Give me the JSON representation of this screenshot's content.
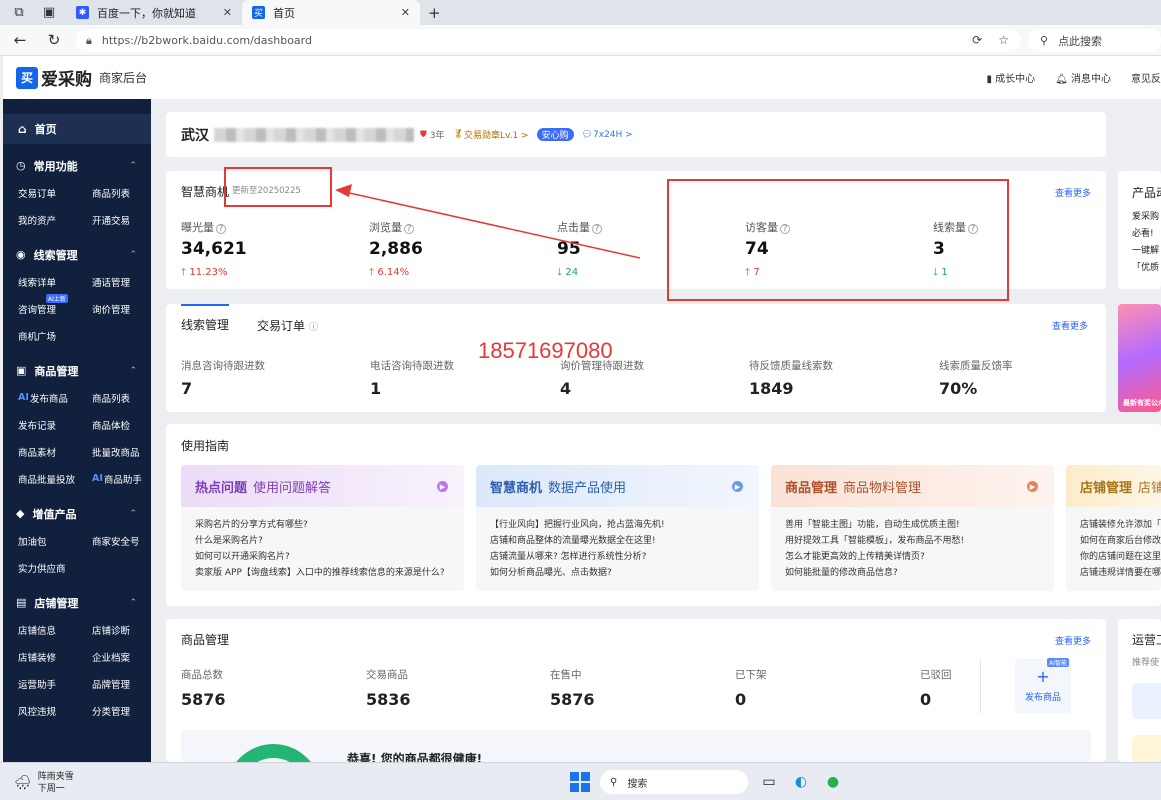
{
  "browser": {
    "tabs": [
      {
        "label": "百度一下，你就知道",
        "icon": "baidu-paw-icon"
      },
      {
        "label": "首页",
        "icon": "b2b-icon"
      }
    ],
    "url": "https://b2bwork.baidu.com/dashboard",
    "search_placeholder": "点此搜索"
  },
  "header": {
    "logo_mark": "买",
    "logo_text": "爱采购",
    "subtitle": "商家后台",
    "links": [
      "成长中心",
      "消息中心",
      "意见反"
    ]
  },
  "sidebar": {
    "home": "首页",
    "groups": [
      {
        "title": "常用功能",
        "items": [
          "交易订单",
          "商品列表",
          "我的资产",
          "开通交易"
        ]
      },
      {
        "title": "线索管理",
        "items": [
          "线索详单",
          "通话管理",
          "咨询管理",
          "询价管理",
          "商机广场"
        ],
        "badge": "AI上新"
      },
      {
        "title": "商品管理",
        "items": [
          "发布商品",
          "商品列表",
          "发布记录",
          "商品体检",
          "商品素材",
          "批量改商品",
          "商品批量投放",
          "商品助手"
        ]
      },
      {
        "title": "增值产品",
        "items": [
          "加油包",
          "商家安全号",
          "实力供应商"
        ]
      },
      {
        "title": "店铺管理",
        "items": [
          "店铺信息",
          "店铺诊断",
          "店铺装修",
          "企业档案",
          "运营助手",
          "品牌管理",
          "风控违规",
          "分类管理"
        ]
      }
    ]
  },
  "shop": {
    "name_prefix": "武汉",
    "years": "3年",
    "level": "交易勋章Lv.1 >",
    "assurance": "安心购",
    "service": "7x24H >"
  },
  "smart": {
    "title": "智慧商机",
    "updated": "更新至20250225",
    "more": "查看更多",
    "metrics": [
      {
        "label": "曝光量",
        "value": "34,621",
        "change": "11.23%",
        "dir": "up"
      },
      {
        "label": "浏览量",
        "value": "2,886",
        "change": "6.14%",
        "dir": "up"
      },
      {
        "label": "点击量",
        "value": "95",
        "change": "24",
        "dir": "down"
      },
      {
        "label": "访客量",
        "value": "74",
        "change": "7",
        "dir": "up"
      },
      {
        "label": "线索量",
        "value": "3",
        "change": "1",
        "dir": "down"
      }
    ]
  },
  "leads": {
    "tabs": [
      "线索管理",
      "交易订单"
    ],
    "more": "查看更多",
    "metrics": [
      {
        "label": "消息咨询待跟进数",
        "value": "7"
      },
      {
        "label": "电话咨询待跟进数",
        "value": "1"
      },
      {
        "label": "询价管理待跟进数",
        "value": "4"
      },
      {
        "label": "待反馈质量线索数",
        "value": "1849"
      },
      {
        "label": "线索质量反馈率",
        "value": "70%"
      }
    ]
  },
  "overlay_phone": "18571697080",
  "guide": {
    "title": "使用指南",
    "cards": [
      {
        "bold": "热点问题",
        "rest": "使用问题解答",
        "color": "#7b3fb8",
        "bg": "#efe3f8",
        "dot": "#b678e8",
        "items": [
          "采购名片的分享方式有哪些?",
          "什么是采购名片?",
          "如何可以开通采购名片?",
          "卖家版 APP【询盘线索】入口中的推荐线索信息的来源是什么?"
        ]
      },
      {
        "bold": "智慧商机",
        "rest": "数据产品使用",
        "color": "#2d5fb0",
        "bg": "#e2ecfa",
        "dot": "#6b9be8",
        "items": [
          "【行业风向】把握行业风向，抢占蓝海先机!",
          "店铺和商品整体的流量曝光数据全在这里!",
          "店铺流量从哪来? 怎样进行系统性分析?",
          "如何分析商品曝光、点击数据?"
        ]
      },
      {
        "bold": "商品管理",
        "rest": "商品物料管理",
        "color": "#b0502d",
        "bg": "#fbe9df",
        "dot": "#e8845b",
        "items": [
          "善用「智能主图」功能，自动生成优质主图!",
          "用好提效工具「智能模板」，发布商品不用愁!",
          "怎么才能更高效的上传精美详情页?",
          "如何能批量的修改商品信息?"
        ]
      },
      {
        "bold": "店铺管理",
        "rest": "店铺",
        "color": "#a8741a",
        "bg": "#fdf0d6",
        "dot": "#e8b45b",
        "items": [
          "店铺装修允许添加「",
          "如何在商家后台修改",
          "你的店铺问题在这里",
          "店铺违规详情要在哪"
        ]
      }
    ]
  },
  "products": {
    "title": "商品管理",
    "more": "查看更多",
    "metrics": [
      {
        "label": "商品总数",
        "value": "5876"
      },
      {
        "label": "交易商品",
        "value": "5836"
      },
      {
        "label": "在售中",
        "value": "5876"
      },
      {
        "label": "已下架",
        "value": "0"
      },
      {
        "label": "已驳回",
        "value": "0"
      }
    ],
    "publish": "发布商品",
    "publish_badge": "AI智能",
    "health": "恭喜! 您的商品都很健康!"
  },
  "right": {
    "product_title": "产品动",
    "product_lines": [
      "爱采购",
      "必看!",
      "一键解",
      "「优质"
    ],
    "promo_text": "最新有奖公众",
    "ops_title": "运营工",
    "ops_sub": "推荐使"
  },
  "taskbar": {
    "weather_title": "阵雨夹雪",
    "weather_sub": "下周一",
    "search": "搜索"
  },
  "colors": {
    "brand": "#1366e8",
    "sidebar": "#10203d",
    "up": "#e53935",
    "down": "#22a06b",
    "link": "#2962ff"
  }
}
